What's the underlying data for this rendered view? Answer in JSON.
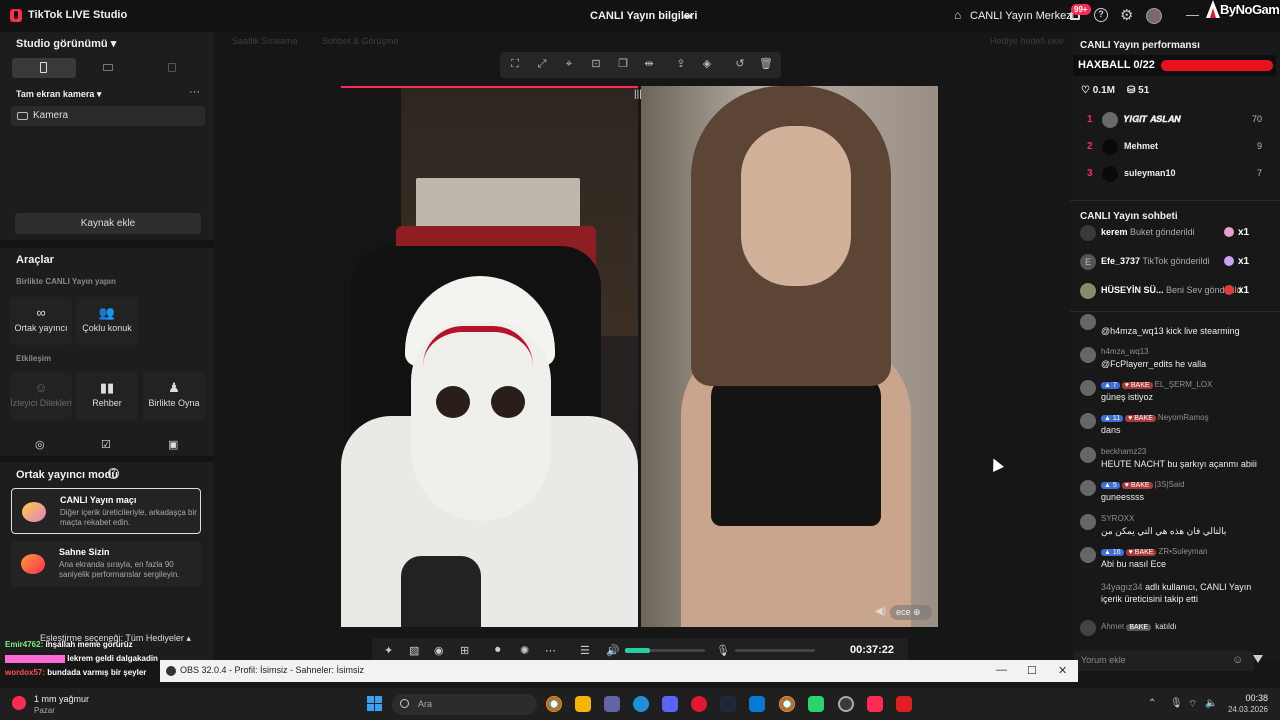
{
  "titlebar": {
    "app_title": "TikTok LIVE Studio",
    "center_title": "CANLI Yayın bilgileri",
    "live_center": "CANLI Yayın Merkezi",
    "notif_badge": "99+",
    "watermark": "ByNoGame"
  },
  "left": {
    "studio_view": "Studio görünümü ▾",
    "camera_header": "Tam ekran kamera ▾",
    "camera_item": "Kamera",
    "add_source": "Kaynak ekle",
    "tools_title": "Araçlar",
    "live_together": "Birlikte CANLI Yayın yapın",
    "tools_row1": [
      {
        "label": "Ortak yayıncı",
        "icon": "link-icon"
      },
      {
        "label": "Çoklu konuk",
        "icon": "users-icon"
      }
    ],
    "interaction_title": "Etkileşim",
    "tools_row2": [
      {
        "label": "İzleyici Dilekleri",
        "icon": "wish-icon",
        "disabled": true
      },
      {
        "label": "Rehber",
        "icon": "book-icon"
      },
      {
        "label": "Birlikte Oyna",
        "icon": "play-together-icon"
      }
    ],
    "cohost_mode": "Ortak yayıncı modu",
    "cards": [
      {
        "title": "CANLI Yayın maçı",
        "desc": "Diğer içerik üreticileriyle, arkadaşça bir maçta rekabet edin."
      },
      {
        "title": "Sahne Sizin",
        "desc": "Ana ekranda sırayla, en fazla 90 saniyelik performanslar sergileyin."
      }
    ],
    "match_pref": "Eşleştirme seçeneği: Tüm Hediyeler ▴"
  },
  "stage": {
    "top_left_1": "Saatlik Sıralama",
    "top_left_2": "Sohbet & Görüşme",
    "top_right": "Hediye hedefi ekle",
    "guest_name": "ece",
    "timer": "00:37:22",
    "volume_level": 0.31
  },
  "overlay_chat": [
    {
      "user": "Emir4762:",
      "text": "inşallah meme görürüz",
      "color": "#7cf27c"
    },
    {
      "user": "",
      "text": "lekrem geldi dalgakadin",
      "color": "#ff6ad5"
    },
    {
      "user": "wordox57:",
      "text": "bundada varmış bir şeyler",
      "color": "#ff5252"
    }
  ],
  "right": {
    "perf_title": "CANLI Yayın performansı",
    "haxball": "HAXBALL 0/22",
    "likes": "0.1M",
    "viewers": "51",
    "ranking": [
      {
        "rank": "1",
        "name": "𝒀𝑰𝑮̆𝑰𝑻 𝑨𝑺𝑳𝑨𝑵",
        "value": "70"
      },
      {
        "rank": "2",
        "name": "Mehmet",
        "value": "9"
      },
      {
        "rank": "3",
        "name": "suleyman10",
        "value": "7"
      }
    ],
    "chat_title": "CANLI Yayın sohbeti",
    "gifts": [
      {
        "user": "kerem",
        "text": "Buket gönderildi",
        "count": "x1",
        "gem": "#e8a0d0"
      },
      {
        "user": "Efe_3737",
        "text": "TikTok gönderildi",
        "count": "x1",
        "gem": "#c9a3f0"
      },
      {
        "user": "HÜSEYİN SÜ...",
        "text": "Beni Sev gönderildi",
        "count": "x1",
        "gem": "#e23b3b"
      }
    ],
    "messages": [
      {
        "badges": "",
        "name": "",
        "text": "@h4mza_wq13 kick live stearming"
      },
      {
        "badges": "",
        "name": "h4mza_wq13",
        "text": "@FcPlayerr_edits he valla"
      },
      {
        "badges": "7",
        "name": "EL_ŞERM_LOX",
        "text": "güneş istiyoz"
      },
      {
        "badges": "11",
        "name": "NeyomRamoş",
        "text": "dans"
      },
      {
        "badges": "",
        "name": "beckhamz23",
        "text": "HEUTE NACHT bu şarkıyı açanmı abiii"
      },
      {
        "badges": "5",
        "name": "|3S|Said",
        "text": "guneessss"
      },
      {
        "badges": "",
        "name": "SYROXX",
        "text": "بالتالي فان هذه هي التي يمكن من"
      },
      {
        "badges": "16",
        "name": "ZR•Suleyman",
        "text": "Abi bu nasıl Ece"
      }
    ],
    "follow_notice_user": "34yagız34",
    "follow_notice_text": "adlı kullanıcı, CANLI Yayın içerik üreticisini takip etti",
    "joined_user": "Ahmet",
    "joined_text": "katıldı",
    "bake_label": "BAKE",
    "chat_placeholder": "Yorum ekle"
  },
  "obs": {
    "title": "OBS 32.0.4 - Profil: İsimsiz - Sahneler: İsimsiz"
  },
  "taskbar": {
    "weather": "1 mm yağmur",
    "weather_sub": "Pazar",
    "search": "Ara",
    "time": "00:38",
    "date": "24.03.2026"
  }
}
